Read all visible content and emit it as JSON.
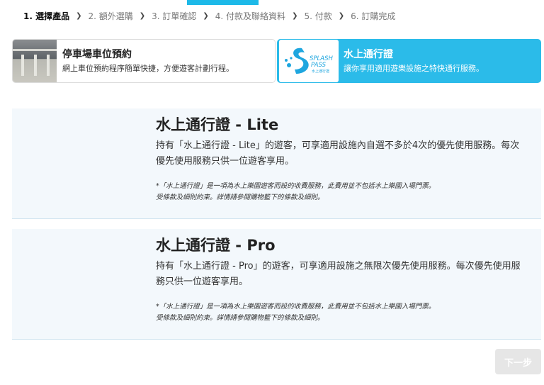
{
  "steps": [
    {
      "label": "1. 選擇產品",
      "active": true
    },
    {
      "label": "2. 額外選購",
      "active": false
    },
    {
      "label": "3. 訂單確認",
      "active": false
    },
    {
      "label": "4. 付款及聯絡資料",
      "active": false
    },
    {
      "label": "5. 付款",
      "active": false
    },
    {
      "label": "6. 訂購完成",
      "active": false
    }
  ],
  "step_separator": "❯",
  "accent_color": "#1db9e8",
  "tabs": {
    "parking": {
      "title": "停車場車位預約",
      "desc": "網上車位預約程序簡單快捷，方便遊客計劃行程。"
    },
    "splash": {
      "title": "水上通行證",
      "desc": "讓你享用適用遊樂設施之特快通行服務。",
      "logo_line1": "SPLASH",
      "logo_line2": "PASS",
      "logo_line3": "水上通行證",
      "selected": true
    }
  },
  "products": [
    {
      "title": "水上通行證 - Lite",
      "desc": "持有「水上通行證 - Lite」的遊客，可享適用設施內自選不多於4次的優先使用服務。每次優先使用服務只供一位遊客享用。",
      "note1": "*「水上通行證」是一項為水上樂園遊客而設的收費服務，此費用並不包括水上樂園入場門票。",
      "note2": "受條款及細則約束。詳情請參閱購物籃下的條款及細則。"
    },
    {
      "title": "水上通行證 - Pro",
      "desc": "持有「水上通行證 - Pro」的遊客，可享適用設施之無限次優先使用服務。每次優先使用服務只供一位遊客享用。",
      "note1": "*「水上通行證」是一項為水上樂園遊客而設的收費服務，此費用並不包括水上樂園入場門票。",
      "note2": "受條款及細則約束。詳情請參閱購物籃下的條款及細則。"
    }
  ],
  "next_button": {
    "label": "下一步",
    "enabled": false
  }
}
